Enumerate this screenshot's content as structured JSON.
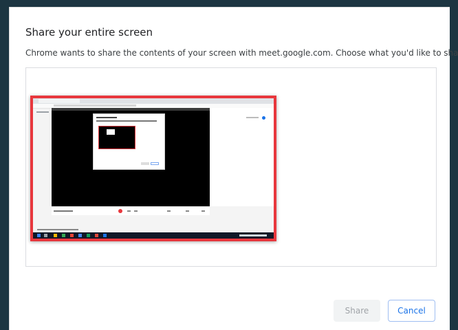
{
  "dialog": {
    "title": "Share your entire screen",
    "subtitle": "Chrome wants to share the contents of your screen with meet.google.com. Choose what you'd like to share."
  },
  "screen_option": {
    "icon": "desktop-screen-thumbnail",
    "selected": true,
    "accent_color": "#e8373d"
  },
  "buttons": {
    "share_label": "Share",
    "cancel_label": "Cancel"
  },
  "colors": {
    "primary": "#1a73e8",
    "selection_border": "#e8373d",
    "disabled_text": "#a0a4a8"
  }
}
